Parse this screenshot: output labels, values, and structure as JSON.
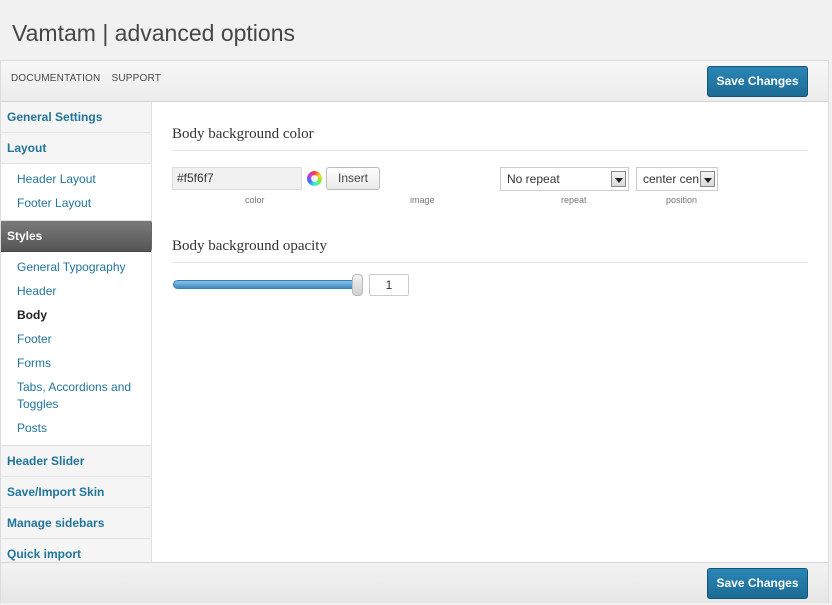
{
  "page": {
    "title": "Vamtam | advanced options"
  },
  "toolbar": {
    "links": [
      "DOCUMENTATION",
      "SUPPORT"
    ],
    "save_label": "Save Changes"
  },
  "sidebar": {
    "sections": [
      {
        "label": "General Settings",
        "items": []
      },
      {
        "label": "Layout",
        "items": [
          "Header Layout",
          "Footer Layout"
        ]
      },
      {
        "label": "Styles",
        "active": true,
        "items": [
          "General Typography",
          "Header",
          "Body",
          "Footer",
          "Forms",
          "Tabs, Accordions and Toggles",
          "Posts"
        ],
        "current_item": "Body"
      },
      {
        "label": "Header Slider",
        "items": []
      },
      {
        "label": "Save/Import Skin",
        "items": []
      },
      {
        "label": "Manage sidebars",
        "items": []
      },
      {
        "label": "Quick import",
        "items": []
      }
    ]
  },
  "main": {
    "bg_color": {
      "title": "Body background color",
      "color_value": "#f5f6f7",
      "insert_label": "Insert",
      "labels": {
        "color": "color",
        "image": "image",
        "repeat": "repeat",
        "position": "position"
      },
      "repeat_value": "No repeat",
      "position_value": "center cen"
    },
    "bg_opacity": {
      "title": "Body background opacity",
      "value": "1",
      "slider_fraction": 1
    }
  },
  "colors": {
    "accent": "#21759b",
    "button": "#2581b1",
    "slider": "#3f8cc4"
  }
}
